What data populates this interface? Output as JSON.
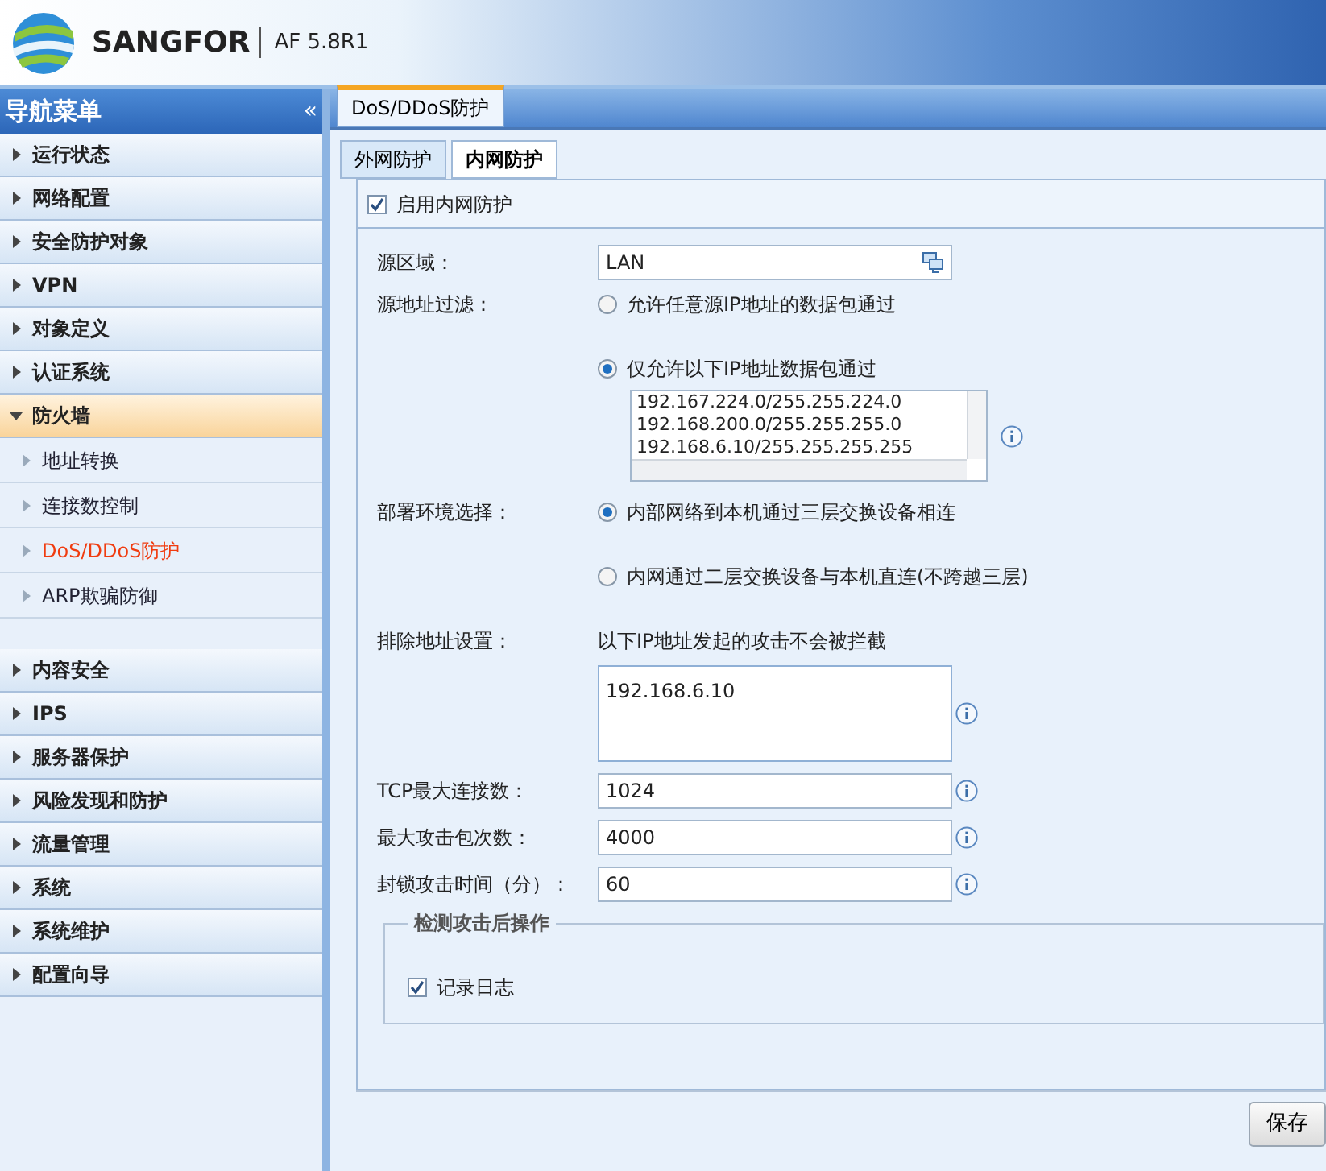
{
  "header": {
    "brand": "SANGFOR",
    "version": "AF 5.8R1"
  },
  "sidebar": {
    "title": "导航菜单",
    "collapse": "«",
    "items": [
      {
        "label": "运行状态",
        "expanded": false
      },
      {
        "label": "网络配置",
        "expanded": false
      },
      {
        "label": "安全防护对象",
        "expanded": false
      },
      {
        "label": "VPN",
        "expanded": false
      },
      {
        "label": "对象定义",
        "expanded": false
      },
      {
        "label": "认证系统",
        "expanded": false
      },
      {
        "label": "防火墙",
        "expanded": true,
        "children": [
          {
            "label": "地址转换",
            "selected": false
          },
          {
            "label": "连接数控制",
            "selected": false
          },
          {
            "label": "DoS/DDoS防护",
            "selected": true
          },
          {
            "label": "ARP欺骗防御",
            "selected": false
          }
        ]
      },
      {
        "label": "内容安全",
        "expanded": false
      },
      {
        "label": "IPS",
        "expanded": false
      },
      {
        "label": "服务器保护",
        "expanded": false
      },
      {
        "label": "风险发现和防护",
        "expanded": false
      },
      {
        "label": "流量管理",
        "expanded": false
      },
      {
        "label": "系统",
        "expanded": false
      },
      {
        "label": "系统维护",
        "expanded": false
      },
      {
        "label": "配置向导",
        "expanded": false
      }
    ]
  },
  "page_tabs": [
    {
      "label": "DoS/DDoS防护",
      "selected": true
    }
  ],
  "sub_tabs": [
    {
      "label": "外网防护",
      "selected": false
    },
    {
      "label": "内网防护",
      "selected": true
    }
  ],
  "enable": {
    "label": "启用内网防护",
    "checked": true
  },
  "source_zone": {
    "label": "源区域：",
    "value": "LAN"
  },
  "source_filter": {
    "label": "源地址过滤：",
    "options": [
      {
        "label": "允许任意源IP地址的数据包通过",
        "selected": false
      },
      {
        "label": "仅允许以下IP地址数据包通过",
        "selected": true
      }
    ],
    "addresses": [
      "192.167.224.0/255.255.224.0",
      "192.168.200.0/255.255.255.0",
      "192.168.6.10/255.255.255.255"
    ]
  },
  "deployment": {
    "label": "部署环境选择：",
    "options": [
      {
        "label": "内部网络到本机通过三层交换设备相连",
        "selected": true
      },
      {
        "label": "内网通过二层交换设备与本机直连(不跨越三层)",
        "selected": false
      }
    ]
  },
  "exclusion": {
    "label": "排除地址设置：",
    "hint": "以下IP地址发起的攻击不会被拦截",
    "value": "192.168.6.10"
  },
  "limits": [
    {
      "label": "TCP最大连接数：",
      "value": "1024"
    },
    {
      "label": "最大攻击包次数：",
      "value": "4000"
    },
    {
      "label": "封锁攻击时间（分）：",
      "value": "60"
    }
  ],
  "post_action": {
    "title": "检测攻击后操作",
    "log": {
      "label": "记录日志",
      "checked": true
    }
  },
  "save_button": "保存"
}
